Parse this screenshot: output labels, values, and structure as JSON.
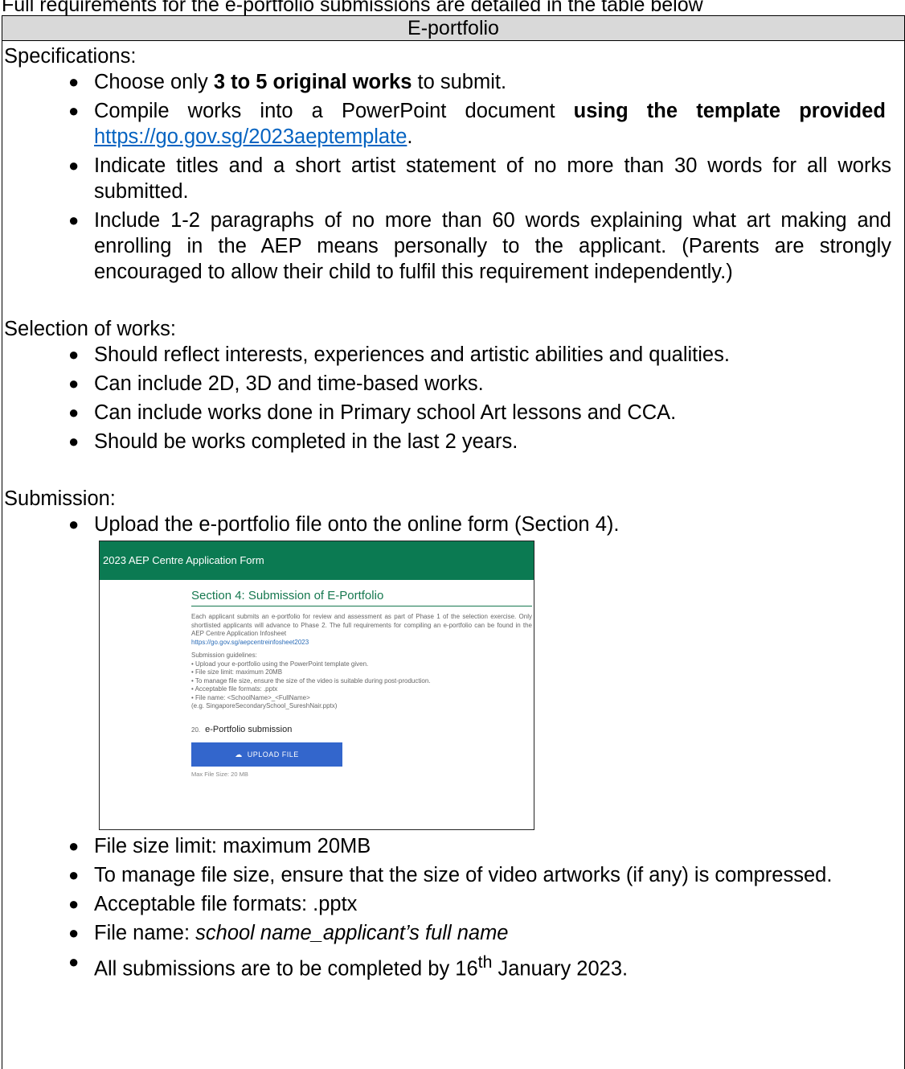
{
  "intro_text": "Full requirements for the e-portfolio submissions are detailed in the table below",
  "table": {
    "header": "E-portfolio",
    "specifications": {
      "heading": "Specifications:",
      "items": [
        {
          "pre": "Choose only ",
          "bold": "3 to 5 original works",
          "post": " to submit."
        },
        {
          "pre": "Compile works into a PowerPoint document ",
          "bold": "using the template provided",
          "link": "https://go.gov.sg/2023aeptemplate",
          "post": "."
        },
        {
          "pre": "Indicate titles and a short artist statement of no more than 30 words for all works submitted."
        },
        {
          "pre": "Include 1-2 paragraphs of no more than 60 words explaining what art making and enrolling in the AEP means personally to the applicant. (Parents are strongly encouraged to allow their child to fulfil this requirement independently.)"
        }
      ]
    },
    "selection": {
      "heading": "Selection of works:",
      "items": [
        "Should reflect interests, experiences and artistic abilities and qualities.",
        "Can include 2D, 3D and time-based works.",
        "Can include works done in Primary school Art lessons and CCA.",
        "Should be works completed in the last 2 years."
      ]
    },
    "submission": {
      "heading": "Submission:",
      "upload_item": "Upload the e-portfolio file onto the online form (Section 4).",
      "items_after": [
        {
          "text": "File size limit: maximum 20MB"
        },
        {
          "text": "To manage file size, ensure that the size of video artworks (if any) is compressed."
        },
        {
          "text": "Acceptable file formats: .pptx"
        },
        {
          "pre": "File name: ",
          "italic": "school name_applicant’s full name"
        },
        {
          "pre": "All submissions are to be completed by 16",
          "sup": "th",
          "post": " January 2023."
        }
      ]
    }
  },
  "embedded_form": {
    "bar_title": "2023 AEP Centre Application Form",
    "section_title": "Section 4: Submission of E-Portfolio",
    "description": "Each applicant submits an e-portfolio for review and assessment as part of Phase 1 of the selection exercise. Only shortlisted applicants will advance to Phase 2. The full requirements for compiling an e-portfolio can be found in the AEP Centre Application Infosheet",
    "description_link": "https://go.gov.sg/aepcentreinfosheet2023",
    "guidelines_heading": "Submission guidelines:",
    "guidelines": [
      "• Upload your e-portfolio using the PowerPoint template given.",
      "• File size limit: maximum 20MB",
      "• To manage file size, ensure the size of the video is suitable during post-production.",
      "• Acceptable file formats: .pptx",
      "• File name: <SchoolName>_<FullName>",
      "(e.g. SingaporeSecondarySchool_SureshNair.pptx)"
    ],
    "question_number": "20.",
    "question_label": "e-Portfolio submission",
    "upload_button": "UPLOAD FILE",
    "max_file_size": "Max File Size: 20 MB",
    "colors": {
      "bar": "#0b7a52",
      "title": "#16784f",
      "button": "#3366cc"
    }
  }
}
